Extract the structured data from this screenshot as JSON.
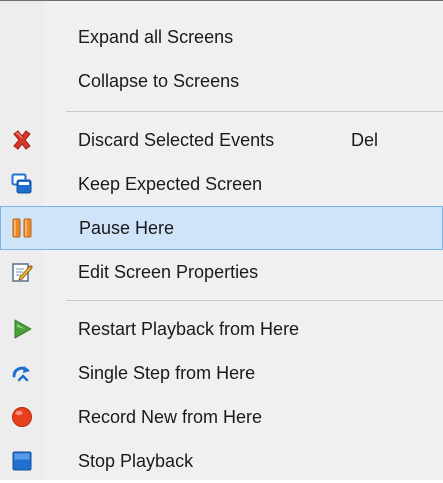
{
  "menu": {
    "items": [
      {
        "label": "Expand all Screens",
        "icon": "none"
      },
      {
        "label": "Collapse to Screens",
        "icon": "none"
      },
      {
        "label": "Discard Selected Events",
        "shortcut": "Del",
        "icon": "red-x-icon"
      },
      {
        "label": "Keep Expected Screen",
        "icon": "keep-screen-icon"
      },
      {
        "label": "Pause Here",
        "icon": "pause-icon",
        "highlighted": true
      },
      {
        "label": "Edit Screen Properties",
        "icon": "edit-properties-icon"
      },
      {
        "label": "Restart Playback from Here",
        "icon": "play-icon"
      },
      {
        "label": "Single Step from Here",
        "icon": "single-step-icon"
      },
      {
        "label": "Record New from Here",
        "icon": "record-icon"
      },
      {
        "label": "Stop Playback",
        "icon": "stop-icon"
      }
    ]
  },
  "colors": {
    "highlight_bg": "#cfe4f9",
    "highlight_border": "#7fb3e6",
    "discard_red": "#d9362a",
    "pause_orange": "#e8892a",
    "play_green": "#4aa13a",
    "record_red": "#e8401e",
    "stop_blue": "#1f6fd1"
  }
}
